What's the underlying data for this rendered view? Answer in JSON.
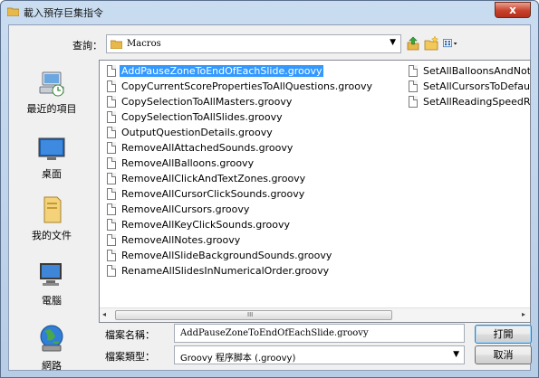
{
  "window": {
    "title": "載入預存巨集指令",
    "close_label": "x"
  },
  "lookin": {
    "label": "查詢：",
    "value": "Macros"
  },
  "places": [
    {
      "label": "最近的項目",
      "icon": "recent-items-icon"
    },
    {
      "label": "桌面",
      "icon": "desktop-icon"
    },
    {
      "label": "我的文件",
      "icon": "documents-icon"
    },
    {
      "label": "電腦",
      "icon": "computer-icon"
    },
    {
      "label": "網路",
      "icon": "network-icon"
    }
  ],
  "files": {
    "column1": [
      "AddPauseZoneToEndOfEachSlide.groovy",
      "CopyCurrentScorePropertiesToAllQuestions.groovy",
      "CopySelectionToAllMasters.groovy",
      "CopySelectionToAllSlides.groovy",
      "OutputQuestionDetails.groovy",
      "RemoveAllAttachedSounds.groovy",
      "RemoveAllBalloons.groovy",
      "RemoveAllClickAndTextZones.groovy",
      "RemoveAllCursorClickSounds.groovy",
      "RemoveAllCursors.groovy",
      "RemoveAllKeyClickSounds.groovy",
      "RemoveAllNotes.groovy",
      "RemoveAllSlideBackgroundSounds.groovy",
      "RenameAllSlidesInNumericalOrder.groovy"
    ],
    "column2": [
      "SetAllBalloonsAndNot",
      "SetAllCursorsToDefaul",
      "SetAllReadingSpeedR"
    ],
    "selected_index": 0
  },
  "scrollbar": {
    "left_arrow": "◂",
    "right_arrow": "▸",
    "grip": "III"
  },
  "filename": {
    "label": "檔案名稱：",
    "value": "AddPauseZoneToEndOfEachSlide.groovy"
  },
  "filetype": {
    "label": "檔案類型：",
    "value": "Groovy 程序脚本 (.groovy)"
  },
  "buttons": {
    "open": "打開",
    "cancel": "取消"
  }
}
